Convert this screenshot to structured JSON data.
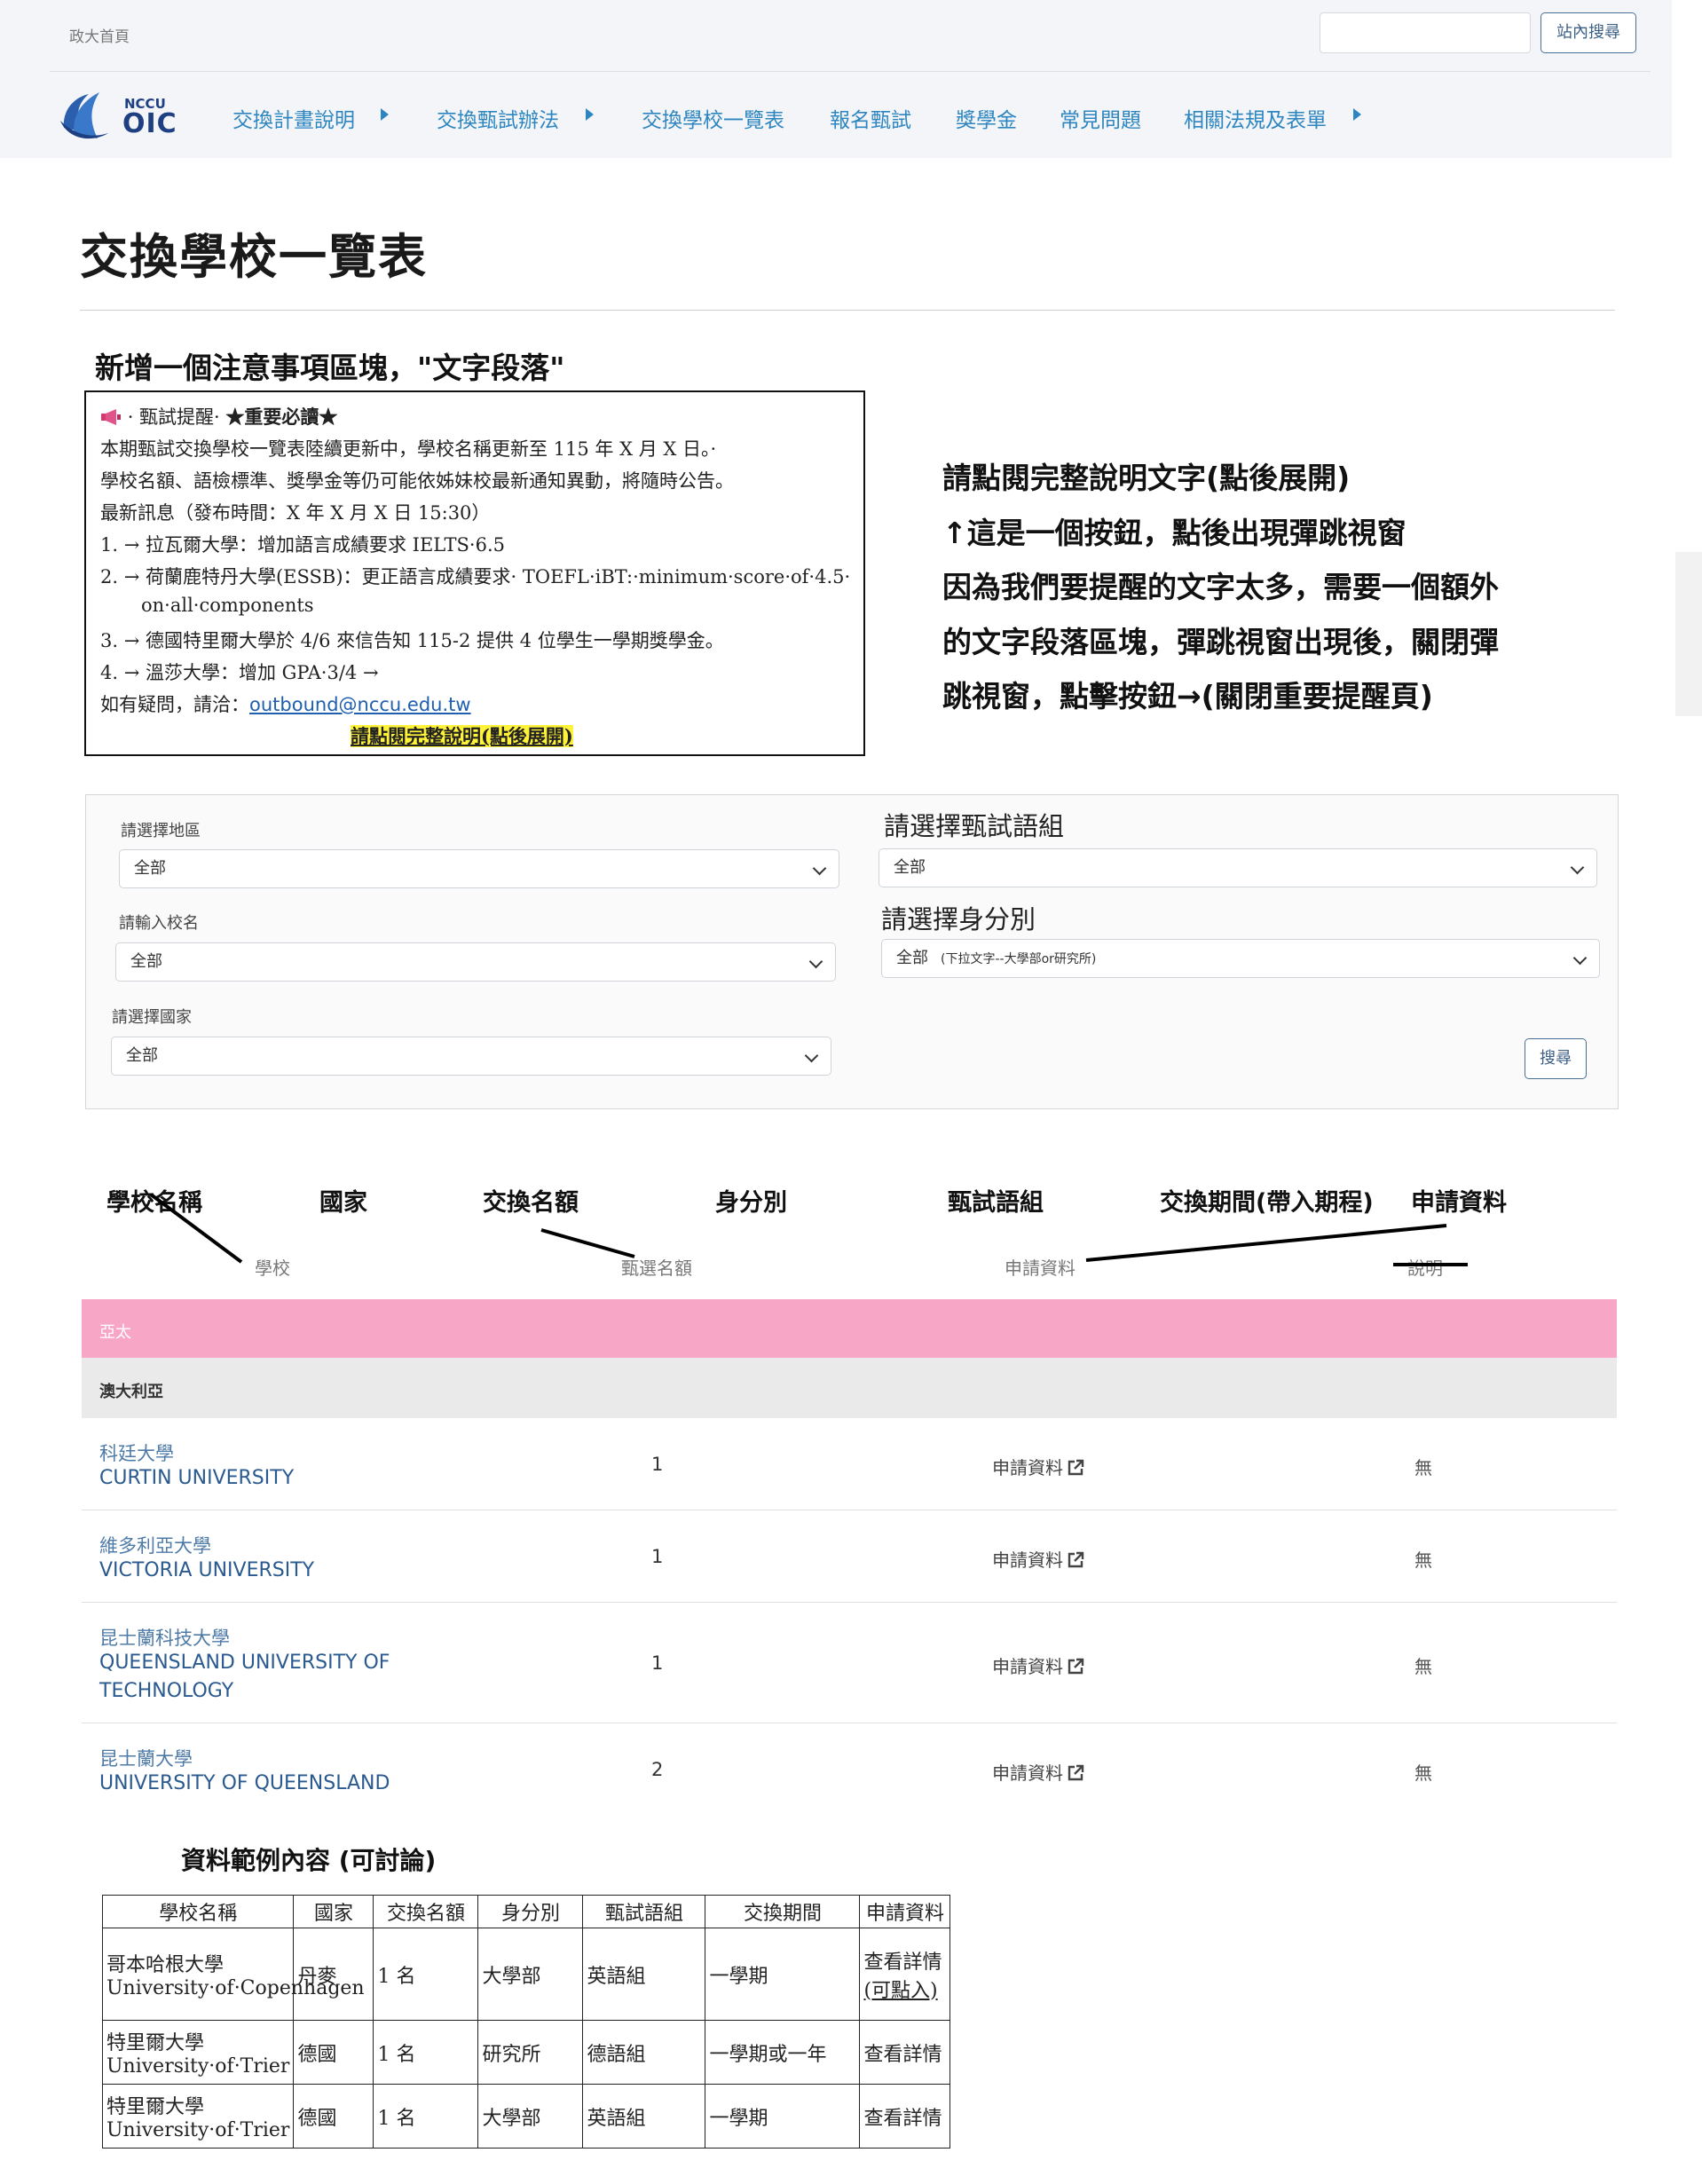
{
  "header": {
    "home_link": "政大首頁",
    "search_placeholder": "",
    "search_button": "站內搜尋",
    "logo_top": "NCCU",
    "logo_bottom": "OIC",
    "nav": [
      {
        "label": "交換計畫說明",
        "has_submenu": true
      },
      {
        "label": "交換甄試辦法",
        "has_submenu": true
      },
      {
        "label": "交換學校一覽表",
        "has_submenu": false
      },
      {
        "label": "報名甄試",
        "has_submenu": false
      },
      {
        "label": "獎學金",
        "has_submenu": false
      },
      {
        "label": "常見問題",
        "has_submenu": false
      },
      {
        "label": "相關法規及表單",
        "has_submenu": true
      }
    ]
  },
  "page": {
    "title": "交換學校一覽表"
  },
  "annotations": {
    "block_heading": "新增一個注意事項區塊，\"文字段落\"",
    "right_note": [
      "請點閱完整說明文字(點後展開)",
      "↑這是一個按鈕，點後出現彈跳視窗",
      "因為我們要提醒的文字太多，需要一個額外",
      "的文字段落區塊，彈跳視窗出現後，關閉彈",
      "跳視窗，點擊按鈕→(關閉重要提醒頁)"
    ],
    "columns": [
      "學校名稱",
      "國家",
      "交換名額",
      "身分別",
      "甄試語組",
      "交換期間(帶入期程)",
      "申請資料"
    ],
    "example_title": "資料範例內容 (可討論)"
  },
  "notice": {
    "heading_prefix": "· 甄試提醒· ",
    "heading_strong": "★重要必讀★",
    "line1": "本期甄試交換學校一覽表陸續更新中，學校名稱更新至 115 年 X 月 X 日。· ",
    "line2": "學校名額、語檢標準、獎學金等仍可能依姊妹校最新通知異動，將隨時公告。",
    "line3": "最新訊息（發布時間：X 年 X 月 X 日 15:30）",
    "items": [
      "1. → 拉瓦爾大學：增加語言成績要求 IELTS·6.5",
      "2. → 荷蘭鹿特丹大學(ESSB)：更正語言成績要求· TOEFL·iBT:·minimum·score·of·4.5·",
      "on·all·components",
      "3. → 德國特里爾大學於 4/6 來信告知 115-2 提供 4 位學生一學期獎學金。",
      "4. → 溫莎大學：增加 GPA·3/4 →"
    ],
    "contact_prefix": "如有疑問，請洽：",
    "contact_email": "outbound@nccu.edu.tw",
    "expand_button": "請點閱完整說明(點後展開)"
  },
  "filters": {
    "region_label": "請選擇地區",
    "region_value": "全部",
    "school_label": "請輸入校名",
    "school_value": "全部",
    "country_label": "請選擇國家",
    "country_value": "全部",
    "language_label": "請選擇甄試語組",
    "language_value": "全部",
    "role_label": "請選擇身分別",
    "role_value": "全部",
    "role_hint": "(下拉文字--大學部or研究所)",
    "search_button": "搜尋"
  },
  "table": {
    "headers": {
      "school": "學校",
      "quota": "甄選名額",
      "apply": "申請資料",
      "note": "說明"
    },
    "region": "亞太",
    "country": "澳大利亞",
    "rows": [
      {
        "zh": "科廷大學",
        "en": "CURTIN UNIVERSITY",
        "quota": "1",
        "apply": "申請資料",
        "note": "無"
      },
      {
        "zh": "維多利亞大學",
        "en": "VICTORIA UNIVERSITY",
        "quota": "1",
        "apply": "申請資料",
        "note": "無"
      },
      {
        "zh": "昆士蘭科技大學",
        "en": "QUEENSLAND UNIVERSITY OF TECHNOLOGY",
        "quota": "1",
        "apply": "申請資料",
        "note": "無"
      },
      {
        "zh": "昆士蘭大學",
        "en": "UNIVERSITY OF QUEENSLAND",
        "quota": "2",
        "apply": "申請資料",
        "note": "無"
      }
    ]
  },
  "example": {
    "headers": [
      "學校名稱",
      "國家",
      "交換名額",
      "身分別",
      "甄試語組",
      "交換期間",
      "申請資料"
    ],
    "rows": [
      {
        "school_zh": "哥本哈根大學",
        "school_en": "University·of·Copenhagen",
        "country": "丹麥",
        "quota": "1 名",
        "role": "大學部",
        "language": "英語組",
        "period": "一學期",
        "apply": "查看詳情",
        "apply_extra": "(可點入)"
      },
      {
        "school_zh": "特里爾大學",
        "school_en": "University·of·Trier",
        "country": "德國",
        "quota": "1 名",
        "role": "研究所",
        "language": "德語組",
        "period": "一學期或一年",
        "apply": "查看詳情",
        "apply_extra": ""
      },
      {
        "school_zh": "特里爾大學",
        "school_en": "University·of·Trier",
        "country": "德國",
        "quota": "1 名",
        "role": "大學部",
        "language": "英語組",
        "period": "一學期",
        "apply": "查看詳情",
        "apply_extra": ""
      }
    ]
  }
}
